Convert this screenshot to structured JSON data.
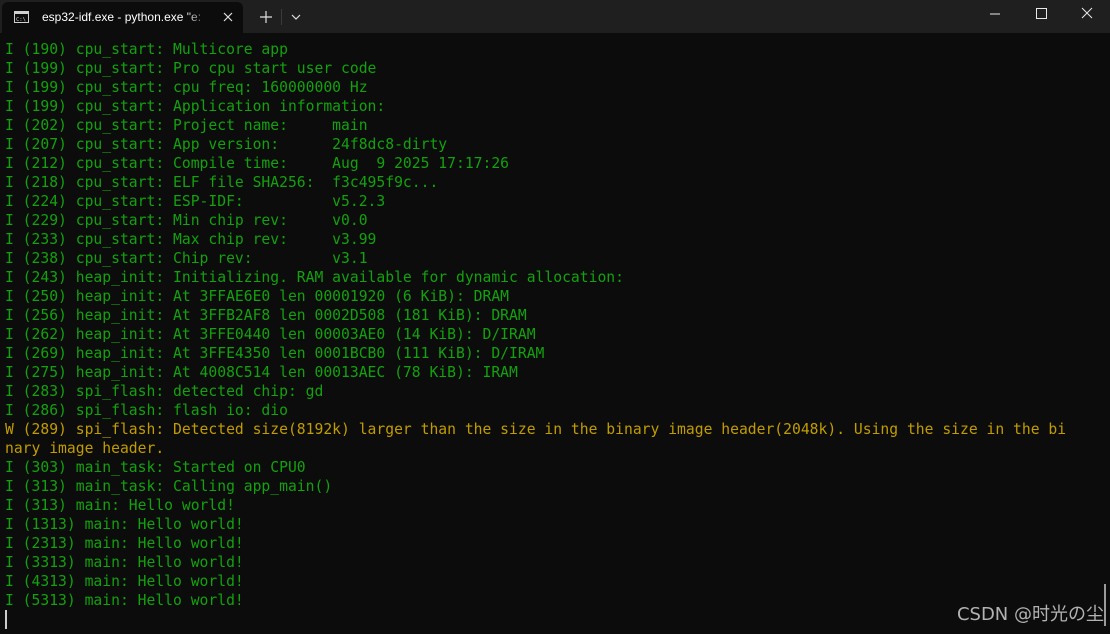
{
  "window": {
    "tab_title": "esp32-idf.exe - python.exe \"e:",
    "tab_icon": "console-icon",
    "colors": {
      "info_text": "#13a10e",
      "warning_text": "#c19c00",
      "background": "#0c0c0c",
      "titlebar": "#1f1f1f"
    }
  },
  "console": {
    "lines": [
      {
        "text": "I (190) cpu_start: Multicore app",
        "level": "info"
      },
      {
        "text": "I (199) cpu_start: Pro cpu start user code",
        "level": "info"
      },
      {
        "text": "I (199) cpu_start: cpu freq: 160000000 Hz",
        "level": "info"
      },
      {
        "text": "I (199) cpu_start: Application information:",
        "level": "info"
      },
      {
        "text": "I (202) cpu_start: Project name:     main",
        "level": "info"
      },
      {
        "text": "I (207) cpu_start: App version:      24f8dc8-dirty",
        "level": "info"
      },
      {
        "text": "I (212) cpu_start: Compile time:     Aug  9 2025 17:17:26",
        "level": "info"
      },
      {
        "text": "I (218) cpu_start: ELF file SHA256:  f3c495f9c...",
        "level": "info"
      },
      {
        "text": "I (224) cpu_start: ESP-IDF:          v5.2.3",
        "level": "info"
      },
      {
        "text": "I (229) cpu_start: Min chip rev:     v0.0",
        "level": "info"
      },
      {
        "text": "I (233) cpu_start: Max chip rev:     v3.99",
        "level": "info"
      },
      {
        "text": "I (238) cpu_start: Chip rev:         v3.1",
        "level": "info"
      },
      {
        "text": "I (243) heap_init: Initializing. RAM available for dynamic allocation:",
        "level": "info"
      },
      {
        "text": "I (250) heap_init: At 3FFAE6E0 len 00001920 (6 KiB): DRAM",
        "level": "info"
      },
      {
        "text": "I (256) heap_init: At 3FFB2AF8 len 0002D508 (181 KiB): DRAM",
        "level": "info"
      },
      {
        "text": "I (262) heap_init: At 3FFE0440 len 00003AE0 (14 KiB): D/IRAM",
        "level": "info"
      },
      {
        "text": "I (269) heap_init: At 3FFE4350 len 0001BCB0 (111 KiB): D/IRAM",
        "level": "info"
      },
      {
        "text": "I (275) heap_init: At 4008C514 len 00013AEC (78 KiB): IRAM",
        "level": "info"
      },
      {
        "text": "I (283) spi_flash: detected chip: gd",
        "level": "info"
      },
      {
        "text": "I (286) spi_flash: flash io: dio",
        "level": "info"
      },
      {
        "text": "W (289) spi_flash: Detected size(8192k) larger than the size in the binary image header(2048k). Using the size in the bi",
        "level": "warn"
      },
      {
        "text": "nary image header.",
        "level": "warn"
      },
      {
        "text": "I (303) main_task: Started on CPU0",
        "level": "info"
      },
      {
        "text": "I (313) main_task: Calling app_main()",
        "level": "info"
      },
      {
        "text": "I (313) main: Hello world!",
        "level": "info"
      },
      {
        "text": "I (1313) main: Hello world!",
        "level": "info"
      },
      {
        "text": "I (2313) main: Hello world!",
        "level": "info"
      },
      {
        "text": "I (3313) main: Hello world!",
        "level": "info"
      },
      {
        "text": "I (4313) main: Hello world!",
        "level": "info"
      },
      {
        "text": "I (5313) main: Hello world!",
        "level": "info"
      }
    ]
  },
  "watermark": "CSDN @时光の尘"
}
